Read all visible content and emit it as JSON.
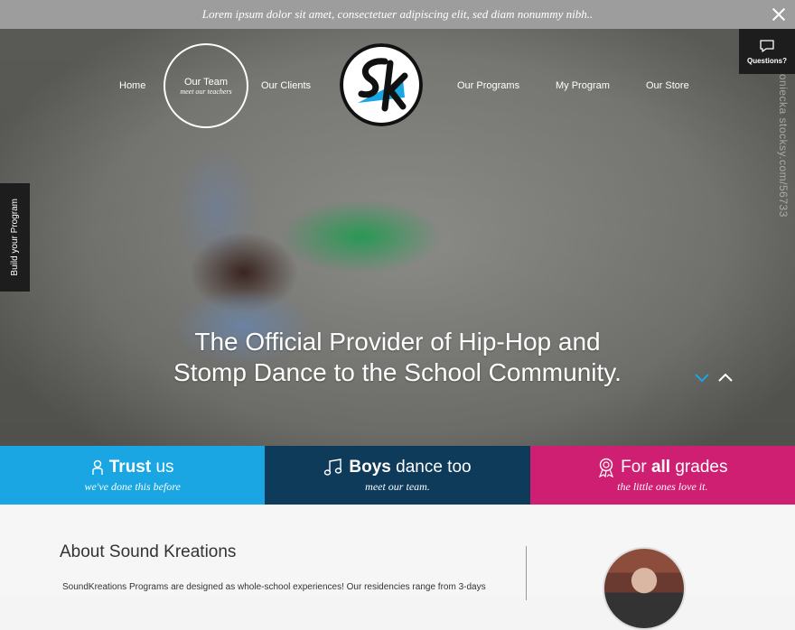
{
  "topbar": {
    "message": "Lorem ipsum dolor sit amet, consectetuer adipiscing elit, sed diam nonummy nibh.."
  },
  "watermark": "n & Boniecka stocksy.com/56733",
  "nav": {
    "left": [
      {
        "label": "Home"
      },
      {
        "label": "Our Team",
        "sub": "meet our teachers"
      },
      {
        "label": "Our Clients"
      }
    ],
    "right": [
      {
        "label": "Our Programs"
      },
      {
        "label": "My Program"
      },
      {
        "label": "Our Store"
      }
    ]
  },
  "questions": {
    "label": "Questions?"
  },
  "build": {
    "label": "Build your Program"
  },
  "hero": {
    "line1": "The Official Provider of Hip-Hop and",
    "line2": "Stomp Dance to the School Community."
  },
  "features": [
    {
      "bold": "Trust",
      "rest": " us",
      "sub": "we've done this before",
      "color": "#19a6e2",
      "icon": "person-icon"
    },
    {
      "bold": "Boys",
      "rest": " dance too",
      "sub": "meet our team.",
      "color": "#0e3b5a",
      "icon": "music-note-icon"
    },
    {
      "pre": "For ",
      "bold": "all",
      "rest": " grades",
      "sub": "the little ones love it.",
      "color": "#cf1f72",
      "icon": "award-icon"
    }
  ],
  "about": {
    "title": "About Sound Kreations",
    "text": "SoundKreations Programs are designed as whole-school experiences! Our residencies range from 3-days"
  }
}
